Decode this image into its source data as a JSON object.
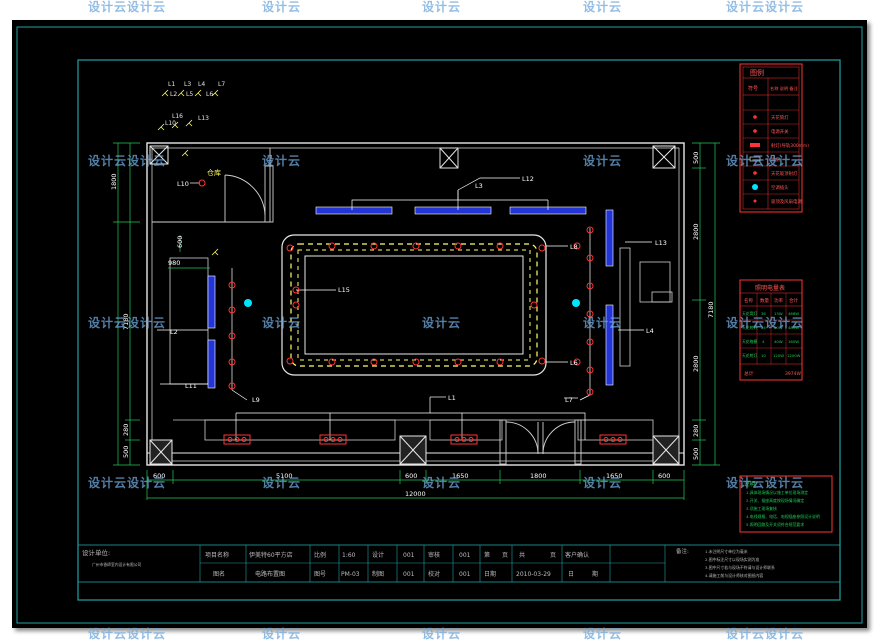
{
  "watermark": "设计云",
  "room": {
    "label": "仓库"
  },
  "lights": {
    "L1": "L1",
    "L2": "L2",
    "L3": "L3",
    "L4": "L4",
    "L5": "L5",
    "L6": "L6",
    "L7": "L7",
    "L8": "L8",
    "L9": "L9",
    "L10": "L10",
    "L11": "L11",
    "L12": "L12",
    "L13": "L13",
    "L14": "L14",
    "L15": "L15",
    "L16": "L16"
  },
  "dimensions": {
    "bottom": [
      "600",
      "5100",
      "600",
      "1650",
      "1800",
      "1650",
      "600"
    ],
    "total": "12000",
    "left": [
      "1800",
      "7180",
      "280",
      "500",
      "600",
      "980"
    ],
    "right": [
      "500",
      "2800",
      "2800",
      "280",
      "500"
    ],
    "right_total": "7180"
  },
  "legend": {
    "title": "图例",
    "col1": "符号",
    "col2": "名称 说明 备注",
    "items": [
      "天花筒灯",
      "电源开关",
      "射灯(导轨300mm)",
      "格栅",
      "天花吸顶射灯",
      "空调插头",
      "吸顶及风扇电源",
      "天花三头射灯"
    ]
  },
  "load_table": {
    "title": "照明电量表",
    "headers": [
      "名称",
      "数量",
      "功率",
      "合计"
    ],
    "rows": [
      [
        "天花筒灯",
        "36",
        "13W",
        "468W"
      ],
      [
        "天花射灯",
        "24",
        "20W",
        "480W"
      ],
      [
        "天花格栅",
        "4",
        "40W",
        "160W"
      ],
      [
        "天花射灯",
        "10",
        "120W",
        "1200W"
      ]
    ],
    "total_label": "总计",
    "total_value": "3974W"
  },
  "notes_green": {
    "title": "说明",
    "items": [
      "1.具体现场情况以施工单位现场测定",
      "2.开关、插座高度按现场情况确定",
      "3.须施工现场复核",
      "4.电线规格、电话、电视插座参照设计说明",
      "5.照明回路及开关须符合规范要求"
    ]
  },
  "title_block": {
    "design_unit_label": "设计单位:",
    "design_unit": "广州市香缔室内设计有限公司",
    "project_name_label": "项目名称",
    "project_name": "伊美特60平方店",
    "drawing_name_label": "图名",
    "drawing_name": "电路布置图",
    "scale_label": "比例",
    "scale": "1:60",
    "drawing_no_label": "图号",
    "drawing_no": "PM-03",
    "design_label": "设计",
    "design": "001",
    "draw_label": "制图",
    "draw": "001",
    "audit_label": "审核",
    "audit": "001",
    "check_label": "校对",
    "check": "001",
    "page_label": "第",
    "page_unit": "页",
    "total_label": "共",
    "total_unit": "页",
    "date_label": "日期",
    "date": "2010-03-29",
    "client_confirm_label": "客户确认",
    "client_date_label": "日",
    "client_date_unit": "期",
    "remarks_label": "备注:",
    "remarks": [
      "1.未注明尺寸单位为毫米",
      "2.图中标注尺寸以现场实测为准",
      "3.图中尺寸若与现场不符请与设计师联系",
      "4.请施工前与设计师核对图纸内容"
    ]
  }
}
